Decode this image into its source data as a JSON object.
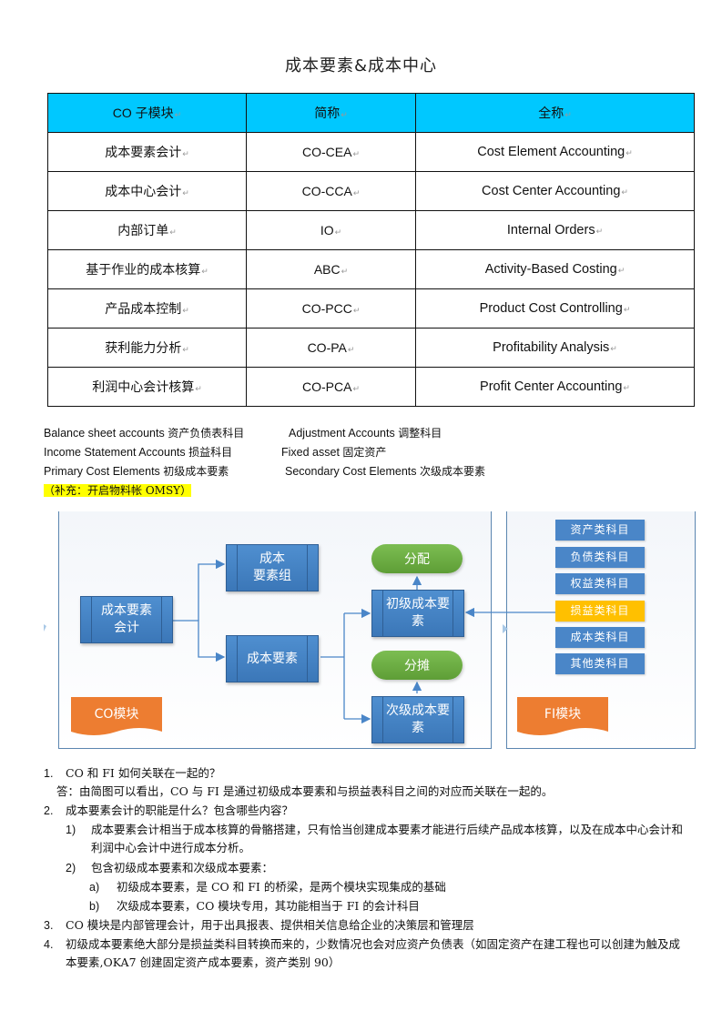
{
  "title": "成本要素&成本中心",
  "table": {
    "headers": [
      "CO 子模块",
      "简称",
      "全称"
    ],
    "rows": [
      [
        "成本要素会计",
        "CO-CEA",
        "Cost Element Accounting"
      ],
      [
        "成本中心会计",
        "CO-CCA",
        "Cost Center Accounting"
      ],
      [
        "内部订单",
        "IO",
        "Internal Orders"
      ],
      [
        "基于作业的成本核算",
        "ABC",
        "Activity-Based Costing"
      ],
      [
        "产品成本控制",
        "CO-PCC",
        "Product Cost Controlling"
      ],
      [
        "获利能力分析",
        "CO-PA",
        "Profitability Analysis"
      ],
      [
        "利润中心会计核算",
        "CO-PCA",
        "Profit Center Accounting"
      ]
    ],
    "header_color": "#00c8ff",
    "paragraph_mark": "↵"
  },
  "glossary": [
    {
      "en": "Balance sheet accounts",
      "cn": "资产负债表科目"
    },
    {
      "en": "Adjustment Accounts",
      "cn": "调整科目"
    },
    {
      "en": "Income Statement Accounts",
      "cn": "损益科目"
    },
    {
      "en": "Fixed asset",
      "cn": "固定资产"
    },
    {
      "en": "Primary Cost Elements",
      "cn": "初级成本要素"
    },
    {
      "en": "Secondary Cost Elements",
      "cn": "次级成本要素"
    }
  ],
  "note": "（补充：开启物料帐 OMSY）",
  "diagram": {
    "co_nodes": {
      "cea": "成本要素会计",
      "ceg": "成本要素组",
      "ce": "成本要素",
      "pce": "初级成本要素",
      "sce": "次级成本要素",
      "alloc1": "分配",
      "alloc2": "分摊"
    },
    "co_tag": "CO模块",
    "fi_tag": "FI模块",
    "fi_items": [
      "资产类科目",
      "负债类科目",
      "权益类科目",
      "损益类科目",
      "成本类科目",
      "其他类科目"
    ],
    "highlighted_fi_item": "损益类科目",
    "colors": {
      "box": "#3b77b8",
      "oval": "#6aaa42",
      "tag": "#ed7d31",
      "highlight": "#ffc000"
    }
  },
  "qa": [
    {
      "num": "1.",
      "text": "CO 和 FI 如何关联在一起的？"
    },
    {
      "num": "",
      "text": "答：由简图可以看出，CO 与 FI 是通过初级成本要素和与损益表科目之间的对应而关联在一起的。"
    },
    {
      "num": "2.",
      "text": "成本要素会计的职能是什么？包含哪些内容？"
    },
    {
      "num": "1)",
      "text": "成本要素会计相当于成本核算的骨骼搭建，只有恰当创建成本要素才能进行后续产品成本核算，以及在成本中心会计和利润中心会计中进行成本分析。"
    },
    {
      "num": "2)",
      "text": "包含初级成本要素和次级成本要素："
    },
    {
      "num": "a)",
      "text": "初级成本要素，是 CO 和 FI 的桥梁，是两个模块实现集成的基础"
    },
    {
      "num": "b)",
      "text": "次级成本要素，CO 模块专用，其功能相当于 FI 的会计科目"
    },
    {
      "num": "3.",
      "text": "CO 模块是内部管理会计，用于出具报表、提供相关信息给企业的决策层和管理层"
    },
    {
      "num": "4.",
      "text": "初级成本要素绝大部分是损益类科目转换而来的，少数情况也会对应资产负债表（如固定资产在建工程也可以创建为触及成本要素,OKA7 创建固定资产成本要素，资产类别 90）"
    }
  ]
}
